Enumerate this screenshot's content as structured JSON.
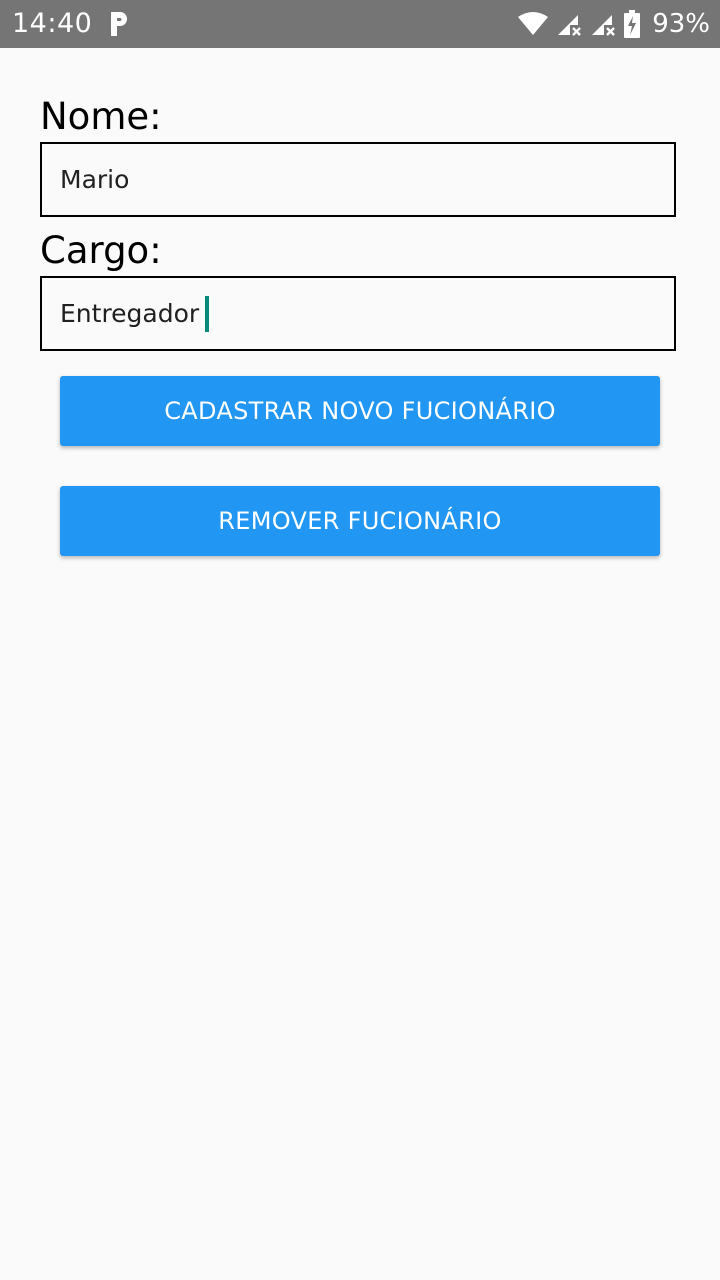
{
  "status_bar": {
    "time": "14:40",
    "notification_icon": "p-icon",
    "wifi_icon": "wifi-icon",
    "signal_icon_1": "signal-no-service-icon",
    "signal_icon_2": "signal-no-service-icon",
    "battery_icon": "battery-charging-icon",
    "battery_percent": "93%"
  },
  "form": {
    "nome_label": "Nome:",
    "nome_value": "Mario",
    "cargo_label": "Cargo:",
    "cargo_value": "Entregador"
  },
  "buttons": {
    "cadastrar_label": "CADASTRAR NOVO FUCIONÁRIO",
    "remover_label": "REMOVER FUCIONÁRIO"
  },
  "colors": {
    "status_bar": "#757575",
    "background": "#fafafa",
    "button": "#2196f3",
    "cursor": "#00897b"
  }
}
